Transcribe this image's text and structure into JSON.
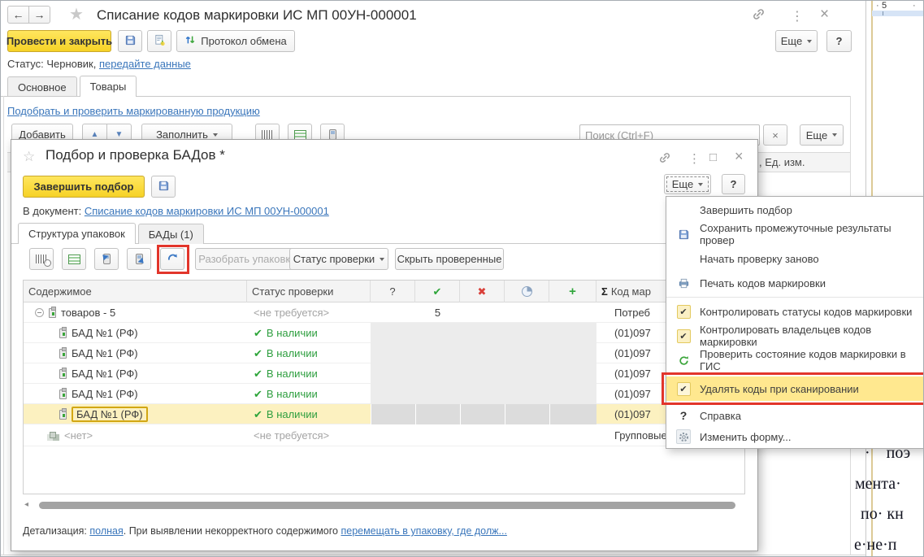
{
  "icons": {
    "back": "←",
    "forward": "→",
    "star": "★",
    "star_outline": "☆",
    "kebab": "⋮",
    "close": "×",
    "maximize": "□",
    "up": "▲",
    "down": "▼",
    "check": "✔",
    "cross": "✖",
    "plus": "+",
    "sigma": "Σ",
    "question": "?",
    "left_arrow": "◂"
  },
  "colors": {
    "accent_yellow": "#f6d226",
    "annotation_red": "#e2352b",
    "row_highlight": "#fcf1c0",
    "success_green": "#2e9e3f",
    "error_red": "#d9403a",
    "link_blue": "#3a76bb"
  },
  "main_window": {
    "title": "Списание кодов маркировки ИС МП 00УН-000001",
    "post_close_button": "Провести и закрыть",
    "protocol_button": "Протокол обмена",
    "more_button": "Еще",
    "help_button": "?",
    "status_label": "Статус:",
    "status_value": "Черновик,",
    "status_link": "передайте данные",
    "tab_main": "Основное",
    "tab_goods": "Товары",
    "pick_link": "Подобрать и проверить маркированную продукцию",
    "add_button": "Добавить",
    "fill_button": "Заполнить",
    "search_placeholder": "Поиск (Ctrl+F)",
    "clear_button": "×",
    "header_fragment": ", Ед. изм."
  },
  "modal": {
    "title": "Подбор и проверка БАДов *",
    "finish_button": "Завершить подбор",
    "more_button": "Еще",
    "help_button": "?",
    "doc_label": "В документ:",
    "doc_link": "Списание кодов маркировки ИС МП 00УН-000001",
    "tab_structure": "Структура упаковок",
    "tab_bads": "БАДы (1)",
    "unpack_button": "Разобрать упаковку",
    "status_filter_button": "Статус проверки",
    "hide_checked_button": "Скрыть проверенные",
    "columns": {
      "content": "Содержимое",
      "status": "Статус проверки",
      "q": "?",
      "code": "Код мар"
    },
    "rows": [
      {
        "name": "товаров - 5",
        "status": "<не требуется>",
        "count": "5",
        "last": "Потреб"
      },
      {
        "name": "БАД №1 (РФ)",
        "status": "В наличии",
        "last": "(01)097"
      },
      {
        "name": "БАД №1 (РФ)",
        "status": "В наличии",
        "last": "(01)097"
      },
      {
        "name": "БАД №1 (РФ)",
        "status": "В наличии",
        "last": "(01)097"
      },
      {
        "name": "БАД №1 (РФ)",
        "status": "В наличии",
        "last": "(01)097"
      },
      {
        "name": "БАД №1 (РФ)",
        "status": "В наличии",
        "last": "(01)097"
      },
      {
        "name": "<нет>",
        "status": "<не требуется>",
        "last": "Групповые упаковки и"
      }
    ],
    "footer": {
      "label": "Детализация:",
      "link1": "полная",
      "middle": ". При выявлении некорректного содержимого",
      "link2": "перемещать в упаковку, где долж..."
    }
  },
  "menu": {
    "items": [
      {
        "label": "Завершить подбор"
      },
      {
        "label": "Сохранить промежуточные результаты провер"
      },
      {
        "label": "Начать проверку заново"
      },
      {
        "label": "Печать кодов маркировки"
      },
      {
        "label": "Контролировать статусы кодов маркировки"
      },
      {
        "label": "Контролировать владельцев кодов маркировки"
      },
      {
        "label": "Проверить состояние кодов маркировки в ГИС"
      },
      {
        "label": "Удалять коды при сканировании"
      },
      {
        "label": "Справка"
      },
      {
        "label": "Изменить форму..."
      }
    ]
  },
  "word_doc": {
    "ruler_number": "5",
    "ruler_tick": "·",
    "lines": [
      "·    поэ",
      "мента·",
      "по· кн",
      "е·не·п"
    ]
  }
}
